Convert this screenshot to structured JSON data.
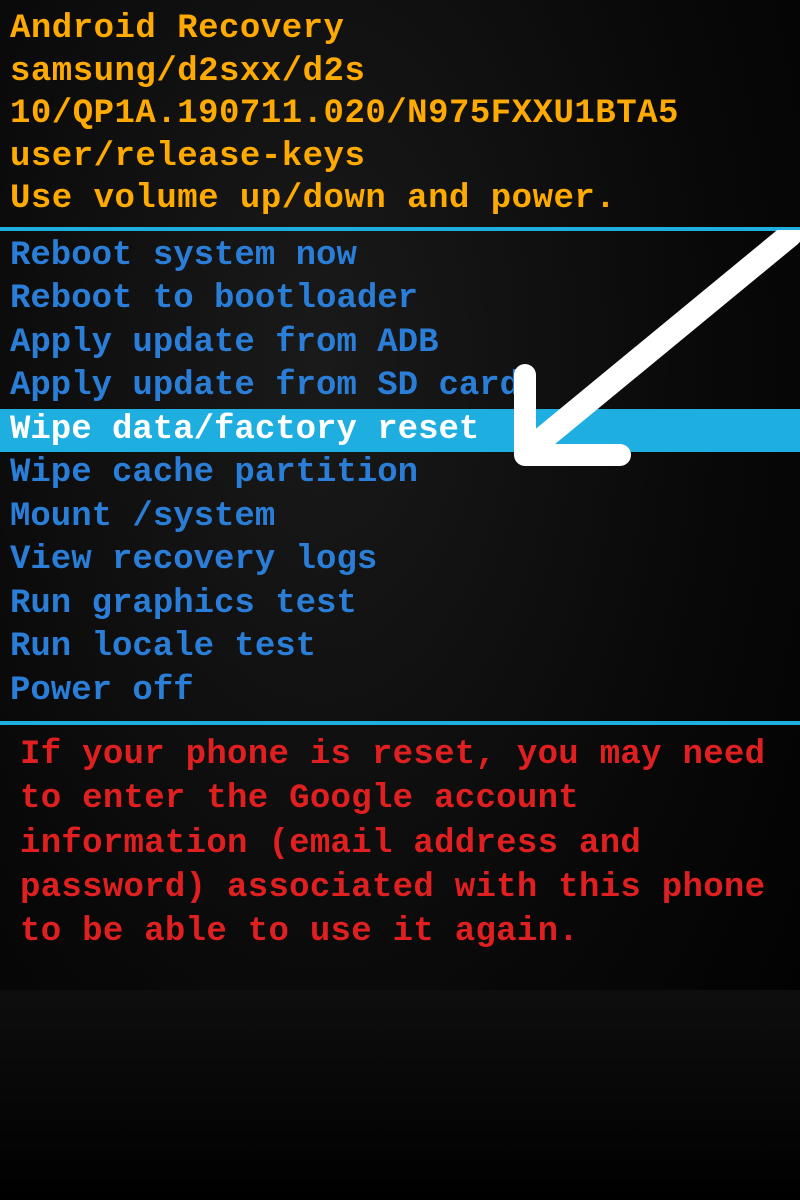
{
  "header": {
    "title": "Android Recovery",
    "device_line1": "samsung/d2sxx/d2s",
    "device_line2": "10/QP1A.190711.020/N975FXXU1BTA5",
    "device_line3": "user/release-keys",
    "instructions": "Use volume up/down and power."
  },
  "menu": {
    "items": [
      {
        "label": "Reboot system now",
        "selected": false
      },
      {
        "label": "Reboot to bootloader",
        "selected": false
      },
      {
        "label": "Apply update from ADB",
        "selected": false
      },
      {
        "label": "Apply update from SD card",
        "selected": false
      },
      {
        "label": "Wipe data/factory reset",
        "selected": true
      },
      {
        "label": "Wipe cache partition",
        "selected": false
      },
      {
        "label": "Mount /system",
        "selected": false
      },
      {
        "label": "View recovery logs",
        "selected": false
      },
      {
        "label": "Run graphics test",
        "selected": false
      },
      {
        "label": "Run locale test",
        "selected": false
      },
      {
        "label": "Power off",
        "selected": false
      }
    ]
  },
  "warning": {
    "text": "If your phone is reset, you may need to enter the Google account information (email address and password) associated with this phone to be able to use it again."
  },
  "annotation": {
    "arrow_icon": "hand-drawn-arrow"
  },
  "colors": {
    "header_text": "#ffaa00",
    "menu_text": "#2a7ed8",
    "highlight_bg": "#1faee0",
    "highlight_text": "#ffffff",
    "warning_text": "#e02020",
    "divider": "#1faee0"
  }
}
